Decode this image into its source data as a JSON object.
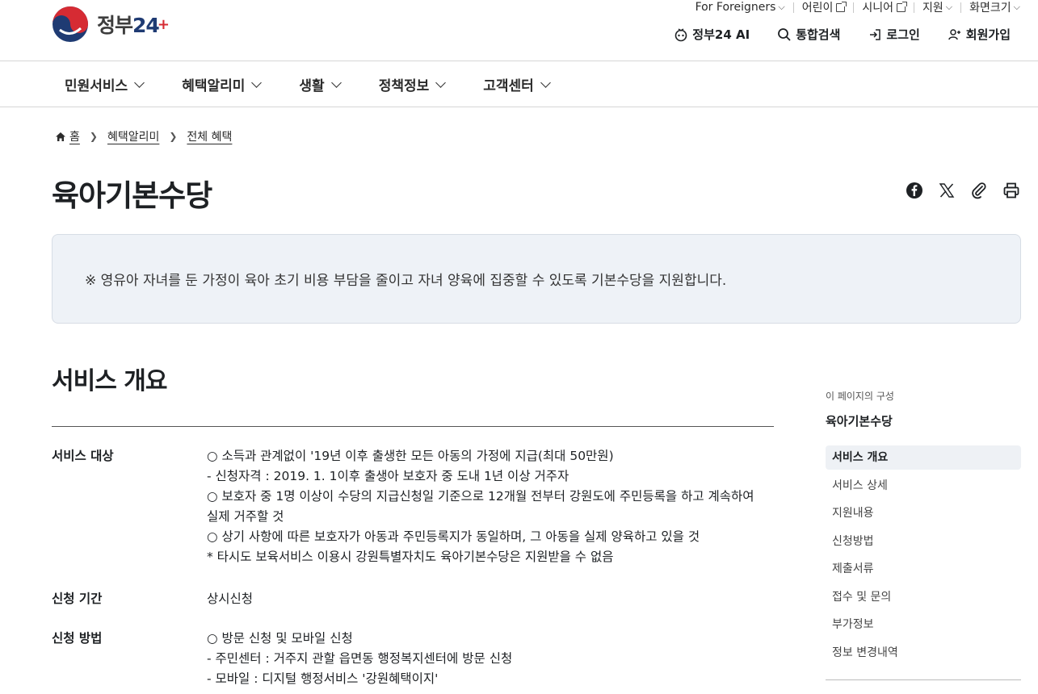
{
  "header": {
    "logo_text": "정부",
    "logo_num": "24",
    "logo_plus": "+",
    "util": [
      {
        "label": "For Foreigners",
        "type": "dropdown"
      },
      {
        "label": "어린이",
        "type": "external"
      },
      {
        "label": "시니어",
        "type": "external"
      },
      {
        "label": "지원",
        "type": "dropdown"
      },
      {
        "label": "화면크기",
        "type": "dropdown"
      }
    ],
    "actions": {
      "ai": "정부24 AI",
      "search": "통합검색",
      "login": "로그인",
      "signup": "회원가입"
    }
  },
  "nav": {
    "items": [
      "민원서비스",
      "혜택알리미",
      "생활",
      "정책정보",
      "고객센터"
    ]
  },
  "breadcrumb": {
    "home": "홈",
    "level1": "혜택알리미",
    "level2": "전체 혜택"
  },
  "page": {
    "title": "육아기본수당",
    "summary": "※ 영유아 자녀를 둔 가정이 육아 초기 비용 부담을 줄이고 자녀 양육에 집중할 수 있도록 기본수당을 지원합니다."
  },
  "section": {
    "title": "서비스 개요",
    "rows": [
      {
        "label": "서비스 대상",
        "lines": [
          "○ 소득과 관계없이 '19년 이후 출생한 모든 아동의 가정에 지급(최대 50만원)",
          "- 신청자격 : 2019. 1. 1이후 출생아 보호자 중 도내 1년 이상 거주자",
          "○ 보호자 중 1명 이상이 수당의 지급신청일 기준으로 12개월 전부터 강원도에 주민등록을 하고 계속하여",
          "실제 거주할 것",
          "○ 상기 사항에 따른 보호자가 아동과 주민등록지가 동일하며, 그 아동을 실제 양육하고 있을 것",
          "* 타시도 보육서비스 이용시 강원특별자치도 육아기본수당은 지원받을 수 없음"
        ]
      },
      {
        "label": "신청 기간",
        "lines": [
          "상시신청"
        ]
      },
      {
        "label": "신청 방법",
        "lines": [
          "○ 방문 신청 및 모바일 신청",
          "- 주민센터 : 거주지 관할 읍면동 행정복지센터에 방문 신청",
          "- 모바일 : 디지털 행정서비스 '강원혜택이지'"
        ]
      }
    ]
  },
  "toc": {
    "caption": "이 페이지의 구성",
    "name": "육아기본수당",
    "items": [
      "서비스 개요",
      "서비스 상세",
      "지원내용",
      "신청방법",
      "제출서류",
      "접수 및 문의",
      "부가정보",
      "정보 변경내역"
    ],
    "active_index": 0
  },
  "colors": {
    "logo_blue": "#1f3b73",
    "logo_red": "#d62b33",
    "summary_bg": "#eef2f7",
    "toc_active_bg": "#eef1f5"
  }
}
